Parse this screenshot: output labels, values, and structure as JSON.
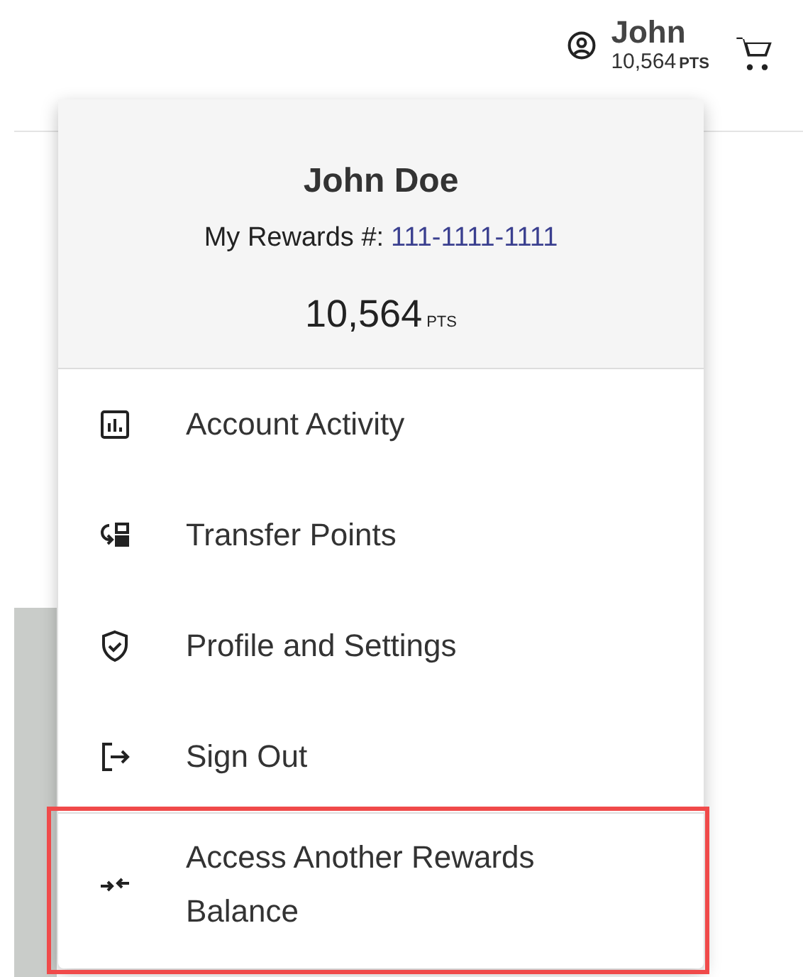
{
  "header": {
    "user_name": "John",
    "points": "10,564",
    "points_unit": "PTS"
  },
  "menu": {
    "full_name": "John Doe",
    "rewards_label": "My Rewards #:",
    "rewards_number": "111-1111-1111",
    "points": "10,564",
    "points_unit": "PTS",
    "items": [
      {
        "kind": "activity",
        "label": "Account Activity",
        "highlighted": false
      },
      {
        "kind": "transfer",
        "label": "Transfer Points",
        "highlighted": false
      },
      {
        "kind": "profile",
        "label": "Profile and Settings",
        "highlighted": false
      },
      {
        "kind": "signout",
        "label": "Sign Out",
        "highlighted": false
      },
      {
        "kind": "access",
        "label": "Access Another Rewards Balance",
        "highlighted": true
      }
    ]
  }
}
